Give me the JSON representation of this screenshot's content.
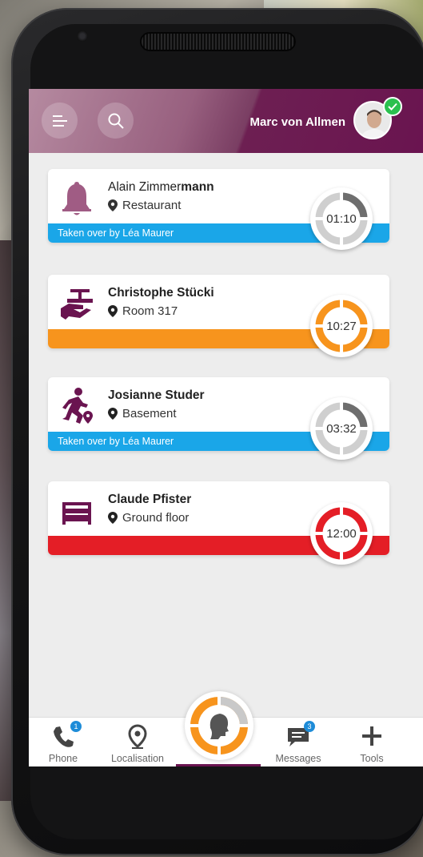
{
  "header": {
    "user_name": "Marc von Allmen",
    "menu_icon": "menu-icon",
    "search_icon": "search-icon"
  },
  "alerts": [
    {
      "name_regular": "Alain Zimmer",
      "name_bold": "mann",
      "location": "Restaurant",
      "status": "Taken over by Léa Maurer",
      "time": "01:10",
      "icon": "bell-icon",
      "bar_color": "#1aa6e8"
    },
    {
      "name": "Christophe Stücki",
      "location": "Room 317",
      "status": "",
      "time": "10:27",
      "icon": "room-service-icon",
      "bar_color": "#f7941d"
    },
    {
      "name": "Josianne Studer",
      "location": "Basement",
      "status": "Taken over by Léa Maurer",
      "time": "03:32",
      "icon": "running-person-icon",
      "bar_color": "#1aa6e8"
    },
    {
      "name": "Claude Pfister",
      "location": "Ground floor",
      "status": "",
      "time": "12:00",
      "icon": "bed-icon",
      "bar_color": "#e41e26"
    }
  ],
  "nav": {
    "phone": {
      "label": "Phone",
      "badge": "1"
    },
    "localisation": {
      "label": "Localisation"
    },
    "messages": {
      "label": "Messages",
      "badge": "3"
    },
    "tools": {
      "label": "Tools"
    }
  },
  "colors": {
    "brand": "#6a1450",
    "orange": "#f7941d",
    "blue": "#1aa6e8",
    "red": "#e41e26"
  }
}
